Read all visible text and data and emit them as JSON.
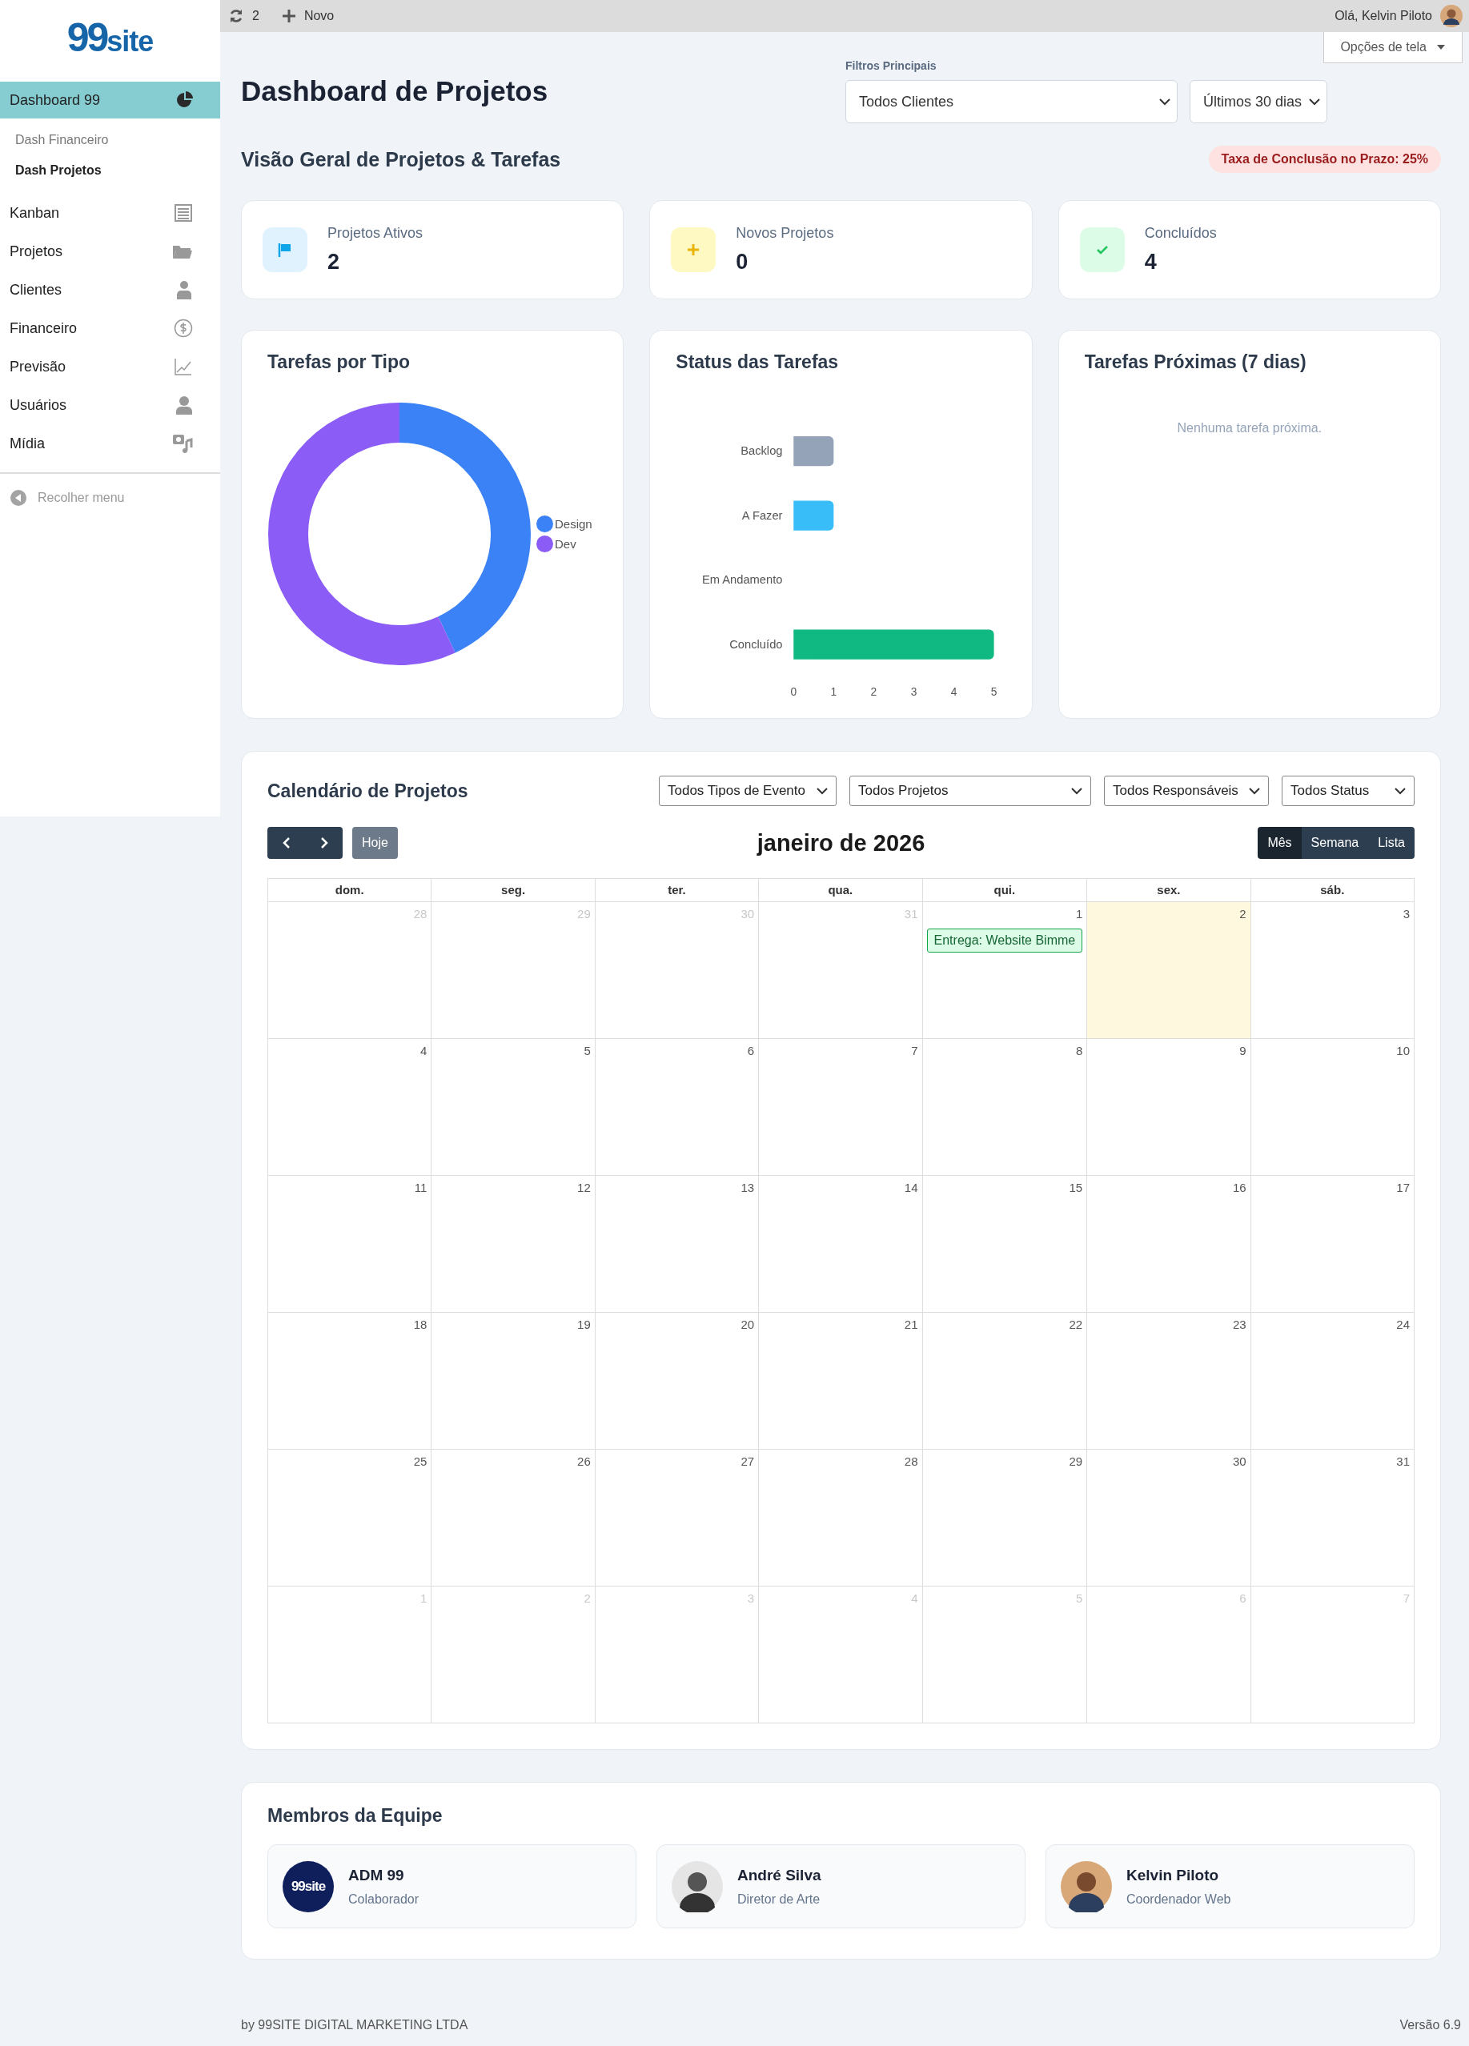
{
  "topbar": {
    "sync_count": "2",
    "new_label": "Novo",
    "greeting": "Olá, Kelvin Piloto",
    "screen_options": "Opções de tela"
  },
  "sidebar": {
    "logo": {
      "big": "99",
      "small": "site"
    },
    "items": [
      {
        "label": "Dashboard 99",
        "selected": true,
        "children": [
          {
            "label": "Dash Financeiro",
            "selected": false
          },
          {
            "label": "Dash Projetos",
            "selected": true
          }
        ]
      },
      {
        "label": "Kanban",
        "selected": false
      },
      {
        "label": "Projetos",
        "selected": false
      },
      {
        "label": "Clientes",
        "selected": false
      },
      {
        "label": "Financeiro",
        "selected": false
      },
      {
        "label": "Previsão",
        "selected": false
      },
      {
        "label": "Usuários",
        "selected": false
      },
      {
        "label": "Mídia",
        "selected": false
      }
    ],
    "collapse": "Recolher menu"
  },
  "page": {
    "title": "Dashboard de Projetos",
    "filters_label": "Filtros Principais",
    "filters": [
      "Todos Clientes",
      "Últimos 30 dias"
    ]
  },
  "overview": {
    "title": "Visão Geral de Projetos & Tarefas",
    "badge": "Taxa de Conclusão no Prazo: 25%"
  },
  "stats": [
    {
      "kind": "flag",
      "label": "Projetos Ativos",
      "value": "2"
    },
    {
      "kind": "plus",
      "label": "Novos Projetos",
      "value": "0"
    },
    {
      "kind": "check",
      "label": "Concluídos",
      "value": "4"
    }
  ],
  "tasks_by_type": {
    "title": "Tarefas por Tipo",
    "legend": [
      {
        "label": "Design",
        "color": "#3b82f6"
      },
      {
        "label": "Dev",
        "color": "#8b5cf6"
      }
    ]
  },
  "task_status": {
    "title": "Status das Tarefas",
    "chart_data": {
      "type": "bar",
      "orientation": "horizontal",
      "categories": [
        "Backlog",
        "A Fazer",
        "Em Andamento",
        "Concluído"
      ],
      "values": [
        1,
        1,
        0,
        5
      ],
      "colors": [
        "#94a3b8",
        "#38bdf8",
        null,
        "#10b981"
      ],
      "xlim": [
        0,
        5
      ],
      "xticks": [
        0,
        1,
        2,
        3,
        4,
        5
      ]
    }
  },
  "upcoming": {
    "title": "Tarefas Próximas (7 dias)",
    "empty": "Nenhuma tarefa próxima."
  },
  "calendar": {
    "title": "Calendário de Projetos",
    "filters": [
      "Todos Tipos de Evento",
      "Todos Projetos",
      "Todos Responsáveis",
      "Todos Status"
    ],
    "today_label": "Hoje",
    "month": "janeiro de 2026",
    "views": [
      {
        "label": "Mês",
        "selected": true
      },
      {
        "label": "Semana",
        "selected": false
      },
      {
        "label": "Lista",
        "selected": false
      }
    ],
    "weekdays": [
      "dom.",
      "seg.",
      "ter.",
      "qua.",
      "qui.",
      "sex.",
      "sáb."
    ],
    "weeks": [
      [
        {
          "day": "28",
          "outside": true
        },
        {
          "day": "29",
          "outside": true
        },
        {
          "day": "30",
          "outside": true
        },
        {
          "day": "31",
          "outside": true
        },
        {
          "day": "1",
          "events": [
            "Entrega: Website Bimme"
          ]
        },
        {
          "day": "2",
          "today": true
        },
        {
          "day": "3"
        }
      ],
      [
        {
          "day": "4"
        },
        {
          "day": "5"
        },
        {
          "day": "6"
        },
        {
          "day": "7"
        },
        {
          "day": "8"
        },
        {
          "day": "9"
        },
        {
          "day": "10"
        }
      ],
      [
        {
          "day": "11"
        },
        {
          "day": "12"
        },
        {
          "day": "13"
        },
        {
          "day": "14"
        },
        {
          "day": "15"
        },
        {
          "day": "16"
        },
        {
          "day": "17"
        }
      ],
      [
        {
          "day": "18"
        },
        {
          "day": "19"
        },
        {
          "day": "20"
        },
        {
          "day": "21"
        },
        {
          "day": "22"
        },
        {
          "day": "23"
        },
        {
          "day": "24"
        }
      ],
      [
        {
          "day": "25"
        },
        {
          "day": "26"
        },
        {
          "day": "27"
        },
        {
          "day": "28"
        },
        {
          "day": "29"
        },
        {
          "day": "30"
        },
        {
          "day": "31"
        }
      ],
      [
        {
          "day": "1",
          "outside": true
        },
        {
          "day": "2",
          "outside": true
        },
        {
          "day": "3",
          "outside": true
        },
        {
          "day": "4",
          "outside": true
        },
        {
          "day": "5",
          "outside": true
        },
        {
          "day": "6",
          "outside": true
        },
        {
          "day": "7",
          "outside": true
        }
      ]
    ]
  },
  "team": {
    "title": "Membros da Equipe",
    "members": [
      {
        "name": "ADM 99",
        "role": "Colaborador",
        "avatar_text": "99site"
      },
      {
        "name": "André Silva",
        "role": "Diretor de Arte"
      },
      {
        "name": "Kelvin Piloto",
        "role": "Coordenador Web"
      }
    ]
  },
  "footer": {
    "left": "by 99SITE DIGITAL MARKETING LTDA",
    "right": "Versão 6.9"
  }
}
